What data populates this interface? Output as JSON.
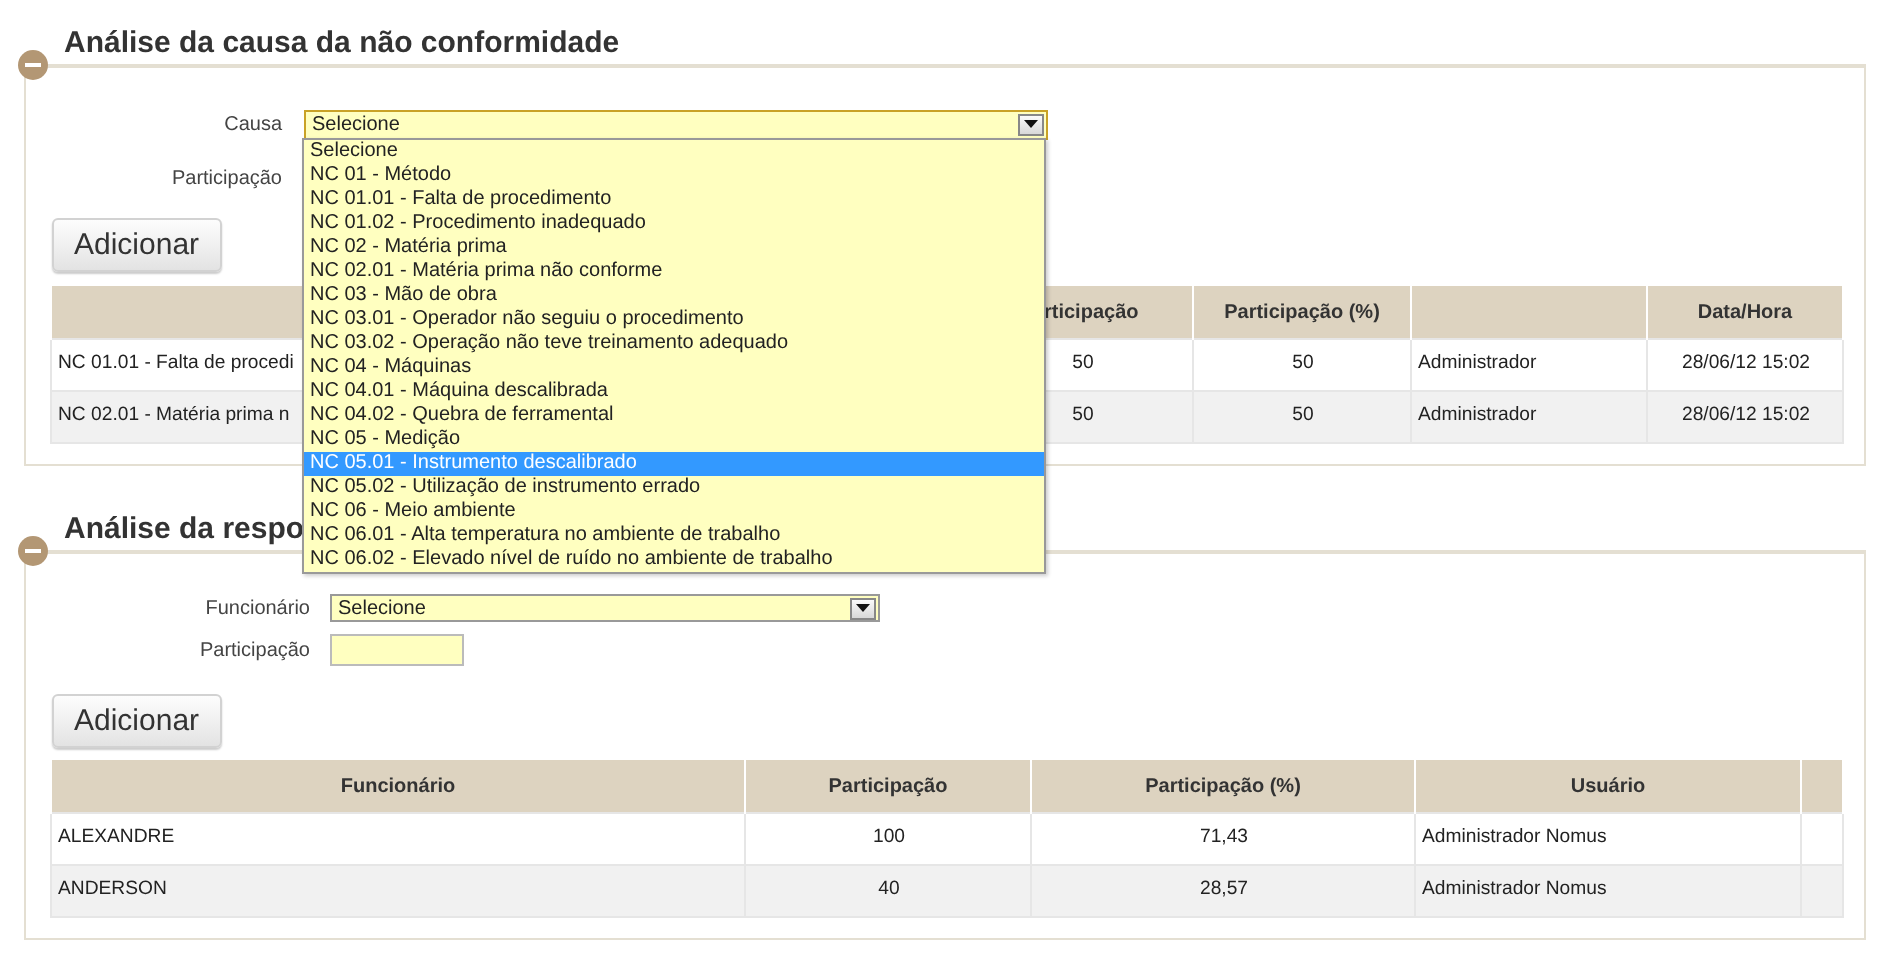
{
  "cause_analysis": {
    "title": "Análise da causa da não conformidade",
    "expanded": true,
    "fields": [
      {
        "label": "Causa",
        "kind": "select",
        "value": "Selecione"
      },
      {
        "label": "Participação",
        "kind": "covered"
      }
    ],
    "dropdown": {
      "options": [
        {
          "label": "Selecione",
          "selected": false
        },
        {
          "label": "NC 01 - Método",
          "selected": false
        },
        {
          "label": "NC 01.01 - Falta de procedimento",
          "selected": false
        },
        {
          "label": "NC 01.02 - Procedimento inadequado",
          "selected": false
        },
        {
          "label": "NC 02 - Matéria prima",
          "selected": false
        },
        {
          "label": "NC 02.01 - Matéria prima não conforme",
          "selected": false
        },
        {
          "label": "NC 03 - Mão de obra",
          "selected": false
        },
        {
          "label": "NC 03.01 - Operador não seguiu o procedimento",
          "selected": false
        },
        {
          "label": "NC 03.02 - Operação não teve treinamento adequado",
          "selected": false
        },
        {
          "label": "NC 04 - Máquinas",
          "selected": false
        },
        {
          "label": "NC 04.01 - Máquina descalibrada",
          "selected": false
        },
        {
          "label": "NC 04.02 - Quebra de ferramental",
          "selected": false
        },
        {
          "label": "NC 05 - Medição",
          "selected": false
        },
        {
          "label": "NC 05.01 - Instrumento descalibrado",
          "selected": true
        },
        {
          "label": "NC 05.02 - Utilização de instrumento errado",
          "selected": false
        },
        {
          "label": "NC 06 - Meio ambiente",
          "selected": false
        },
        {
          "label": "NC 06.01 - Alta temperatura no ambiente de trabalho",
          "selected": false
        },
        {
          "label": "NC 06.02 - Elevado nível de ruído no ambiente de trabalho",
          "selected": false
        }
      ]
    },
    "button": "Adicionar",
    "table": {
      "columns": {
        "column_2": "rticipação",
        "column_3": "Participação (%)",
        "column_5": "Data/Hora"
      },
      "rows": [
        [
          "NC 01.01 - Falta de procedi",
          "50",
          "50",
          "Administrador",
          "28/06/12 15:02"
        ],
        [
          "NC 02.01 - Matéria prima n",
          "50",
          "50",
          "Administrador",
          "28/06/12 15:02"
        ]
      ]
    }
  },
  "responsibility_analysis": {
    "title": "Análise da respo",
    "expanded": true,
    "fields": [
      {
        "label": "Funcionário",
        "kind": "select",
        "value": "Selecione"
      },
      {
        "label": "Participação",
        "kind": "text"
      }
    ],
    "button": "Adicionar",
    "table": {
      "columns": [
        "Funcionário",
        "Participação",
        "Participação (%)",
        "Usuário"
      ],
      "rows": [
        [
          "ALEXANDRE",
          "100",
          "71,43",
          "Administrador Nomus"
        ],
        [
          "ANDERSON",
          "40",
          "28,57",
          "Administrador Nomus"
        ]
      ]
    }
  }
}
